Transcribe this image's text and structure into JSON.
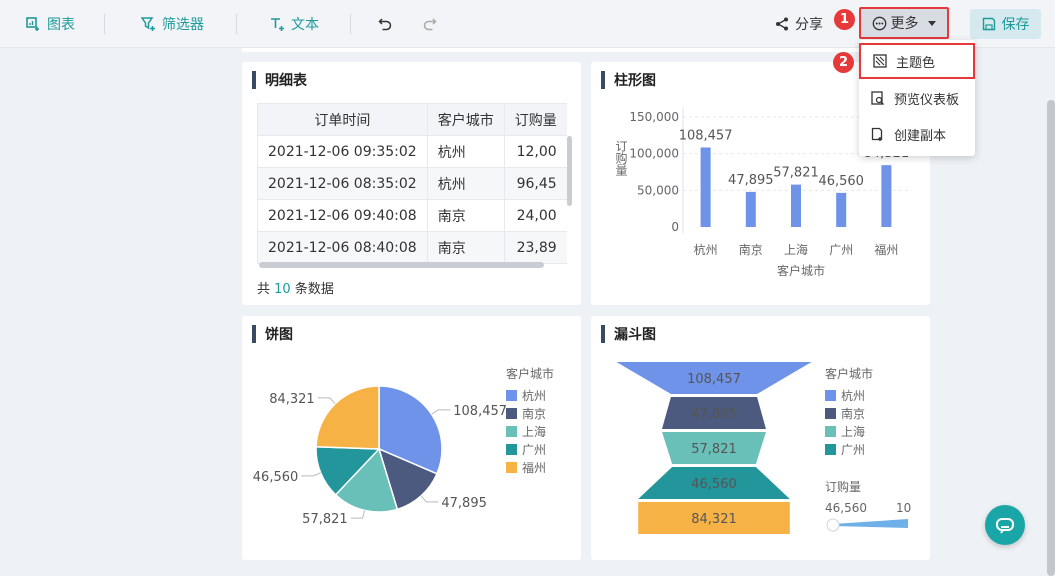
{
  "toolbar": {
    "chart": "图表",
    "filter": "筛选器",
    "text": "文本",
    "share": "分享",
    "more": "更多",
    "save": "保存"
  },
  "steps": {
    "one": "1",
    "two": "2"
  },
  "menu": {
    "theme": "主题色",
    "preview": "预览仪表板",
    "copy": "创建副本"
  },
  "detail": {
    "title": "明细表",
    "columns": [
      "订单时间",
      "客户城市",
      "订购量"
    ],
    "rows": [
      [
        "2021-12-06 09:35:02",
        "杭州",
        "12,00"
      ],
      [
        "2021-12-06 08:35:02",
        "杭州",
        "96,45"
      ],
      [
        "2021-12-06 09:40:08",
        "南京",
        "24,00"
      ],
      [
        "2021-12-06 08:40:08",
        "南京",
        "23,89"
      ]
    ],
    "footer_prefix": "共",
    "footer_count": "10",
    "footer_suffix": "条数据"
  },
  "bar_card": {
    "title": "柱形图"
  },
  "pie_card": {
    "title": "饼图"
  },
  "funnel_card": {
    "title": "漏斗图"
  },
  "colors": {
    "accent": "#1d9a9a",
    "bar": "#6f93e8",
    "hangzhou": "#6f93e8",
    "nanjing": "#4b5a7e",
    "shanghai": "#68c0b8",
    "guangzhou": "#23969c",
    "fuzhou": "#f7b245"
  },
  "chart_data": [
    {
      "type": "bar",
      "categories": [
        "杭州",
        "南京",
        "上海",
        "广州",
        "福州"
      ],
      "values": [
        108457,
        47895,
        57821,
        46560,
        84321
      ],
      "data_labels": [
        "108,457",
        "47,895",
        "57,821",
        "46,560",
        "84,321"
      ],
      "xlabel": "客户城市",
      "ylabel": "订购量",
      "ylim": [
        0,
        150000
      ],
      "yticks": [
        "150,000",
        "100,000",
        "50,000",
        "0"
      ],
      "grid": true
    },
    {
      "type": "pie",
      "categories": [
        "杭州",
        "南京",
        "上海",
        "广州",
        "福州"
      ],
      "values": [
        108457,
        47895,
        57821,
        46560,
        84321
      ],
      "data_labels": [
        "108,457",
        "47,895",
        "57,821",
        "46,560",
        "84,321"
      ],
      "legend_title": "客户城市",
      "legend_position": "right"
    },
    {
      "type": "funnel",
      "categories": [
        "杭州",
        "南京",
        "上海",
        "广州",
        "福州"
      ],
      "values": [
        108457,
        47895,
        57821,
        46560,
        84321
      ],
      "data_labels": [
        "108,457",
        "47,895",
        "57,821",
        "46,560",
        "84,321"
      ],
      "legend_title": "客户城市",
      "size_legend_title": "订购量",
      "size_range_labels": [
        "46,560",
        "10"
      ],
      "legend_position": "right"
    }
  ]
}
